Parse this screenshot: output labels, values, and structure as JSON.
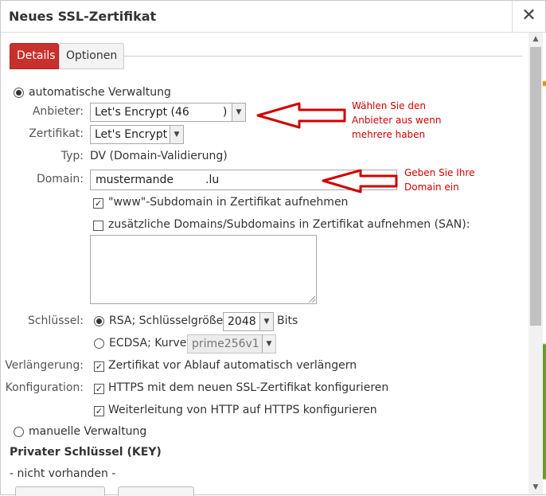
{
  "dialog": {
    "title": "Neues SSL-Zertifikat",
    "close_symbol": "✕"
  },
  "tabs": [
    {
      "label": "Details",
      "active": true
    },
    {
      "label": "Optionen",
      "active": false
    }
  ],
  "auto": {
    "radio_label": "automatische Verwaltung",
    "selected": true
  },
  "provider": {
    "label": "Anbieter:",
    "value": "Let's Encrypt (46",
    "value_tail": ")"
  },
  "certificate": {
    "label": "Zertifikat:",
    "value": "Let's Encrypt"
  },
  "type": {
    "label": "Typ:",
    "value": "DV (Domain-Validierung)"
  },
  "domain": {
    "label": "Domain:",
    "value_part1": "mustermande",
    "value_part2": ".lu",
    "www_checkbox": "\"www\"-Subdomain in Zertifikat aufnehmen",
    "www_checked": true,
    "san_checkbox": "zusätzliche Domains/Subdomains in Zertifikat aufnehmen (SAN):",
    "san_checked": false
  },
  "key": {
    "label": "Schlüssel:",
    "rsa_label": "RSA; Schlüsselgröße:",
    "rsa_selected": true,
    "rsa_size": "2048",
    "rsa_unit": "Bits",
    "ecdsa_label": "ECDSA; Kurve:",
    "ecdsa_curve": "prime256v1"
  },
  "renewal": {
    "label": "Verlängerung:",
    "checkbox": "Zertifikat vor Ablauf automatisch verlängern",
    "checked": true
  },
  "config": {
    "label": "Konfiguration:",
    "https_checkbox": "HTTPS mit dem neuen SSL-Zertifikat konfigurieren",
    "https_checked": true,
    "redirect_checkbox": "Weiterleitung von HTTP auf HTTPS konfigurieren",
    "redirect_checked": true
  },
  "manual": {
    "radio_label": "manuelle Verwaltung",
    "selected": false
  },
  "private_key": {
    "heading": "Privater Schlüssel (KEY)",
    "status": "- nicht vorhanden -"
  },
  "annotations": {
    "provider_note": [
      "Wählen Sie den",
      "Anbieter aus wenn",
      "mehrere haben"
    ],
    "domain_note": [
      "Geben Sie Ihre",
      "Domain ein"
    ]
  },
  "colors": {
    "accent": "#c9302c",
    "annotation": "#d10000"
  }
}
